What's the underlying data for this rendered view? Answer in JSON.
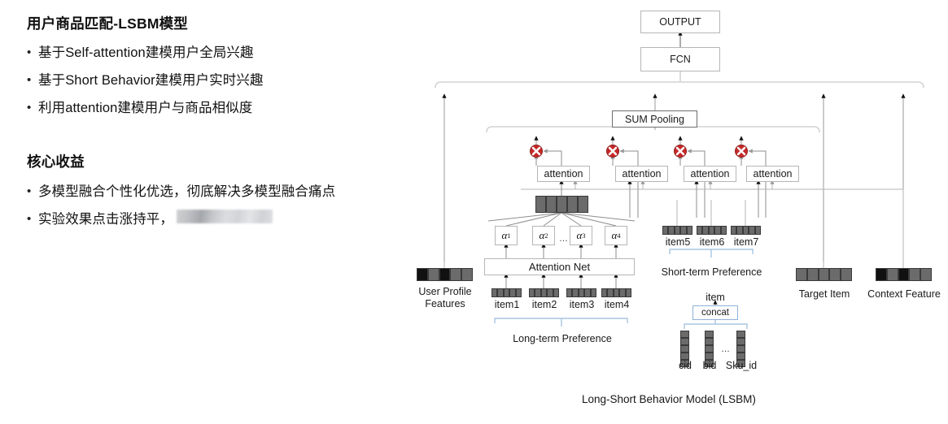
{
  "slide": {
    "section1_title": "用户商品匹配-LSBM模型",
    "section1_bullets": [
      "基于Self-attention建模用户全局兴趣",
      "基于Short Behavior建模用户实时兴趣",
      "利用attention建模用户与商品相似度"
    ],
    "section2_title": "核心收益",
    "section2_bullets": [
      "多模型融合个性化优选，彻底解决多模型融合痛点"
    ],
    "section2_bullet_redacted_prefix": "实验效果点击涨持平，",
    "bullet_marker": "•"
  },
  "diagram": {
    "caption": "Long-Short Behavior Model (LSBM)",
    "output_box": "OUTPUT",
    "fcn_box": "FCN",
    "sum_pooling_box": "SUM Pooling",
    "attention_boxes": [
      "attention",
      "attention",
      "attention",
      "attention"
    ],
    "attention_net_box": "Attention Net",
    "alphas": [
      "α",
      "α",
      "α",
      "α"
    ],
    "alpha_subs": [
      "1",
      "2",
      "3",
      "4"
    ],
    "alpha_ellipsis": "…",
    "long_term_items": [
      "item1",
      "item2",
      "item3",
      "item4"
    ],
    "long_term_label": "Long-term Preference",
    "short_term_items": [
      "item5",
      "item6",
      "item7"
    ],
    "short_term_label": "Short-term Preference",
    "user_profile_label_line1": "User Profile",
    "user_profile_label_line2": "Features",
    "target_item_label": "Target Item",
    "context_feature_label": "Context Feature",
    "item_label": "item",
    "concat_box": "concat",
    "concat_fields": [
      "cid",
      "bid",
      "Sku_id"
    ],
    "concat_ellipsis": "…",
    "colors": {
      "multiply_node": "#cc2222",
      "bracket": "#aac6e0",
      "wire": "#9a9a9a",
      "collector": "#d6d6d6",
      "cell_gray": "#6b6b6b",
      "cell_dark": "#111111"
    }
  }
}
